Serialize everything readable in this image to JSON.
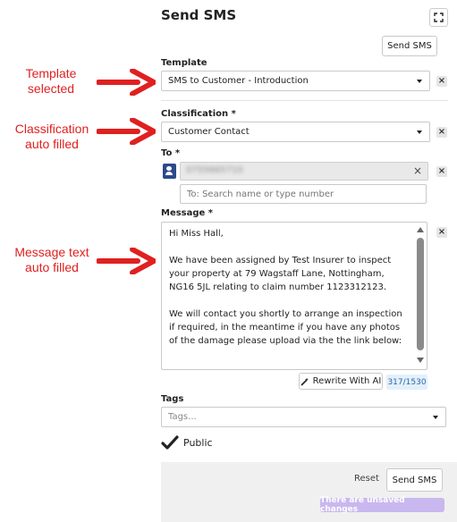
{
  "annotations": {
    "template": "Template\nselected",
    "classification": "Classification\nauto filled",
    "message": "Message text\nauto filled"
  },
  "panel": {
    "title": "Send SMS",
    "top_send_label": "Send SMS"
  },
  "template": {
    "label": "Template",
    "value": "SMS to Customer - Introduction"
  },
  "classification": {
    "label": "Classification *",
    "value": "Customer Contact"
  },
  "to": {
    "label": "To *",
    "recipient": "0755665710",
    "search_placeholder": "To: Search name or type number"
  },
  "message": {
    "label": "Message *",
    "paragraphs": [
      "Hi Miss Hall,",
      "We have been assigned by Test Insurer to inspect your property at 79 Wagstaff Lane, Nottingham,  NG16 5JL relating to claim number 1123312123.",
      "We will contact you shortly to arrange an inspection if required, in the meantime if you have any photos of the damage please upload via the the link below:"
    ],
    "rewrite_label": "Rewrite With AI",
    "char_count": "317/1530"
  },
  "tags": {
    "label": "Tags",
    "placeholder": "Tags..."
  },
  "public": {
    "label": "Public",
    "checked": true
  },
  "footer": {
    "reset_label": "Reset",
    "send_label": "Send SMS",
    "unsaved_text": "There are unsaved changes"
  },
  "colors": {
    "annotation_red": "#e02020",
    "badge_bg": "#c9b8ef",
    "counter_bg": "#e3f0fb",
    "contact_icon": "#2c4a8a"
  }
}
